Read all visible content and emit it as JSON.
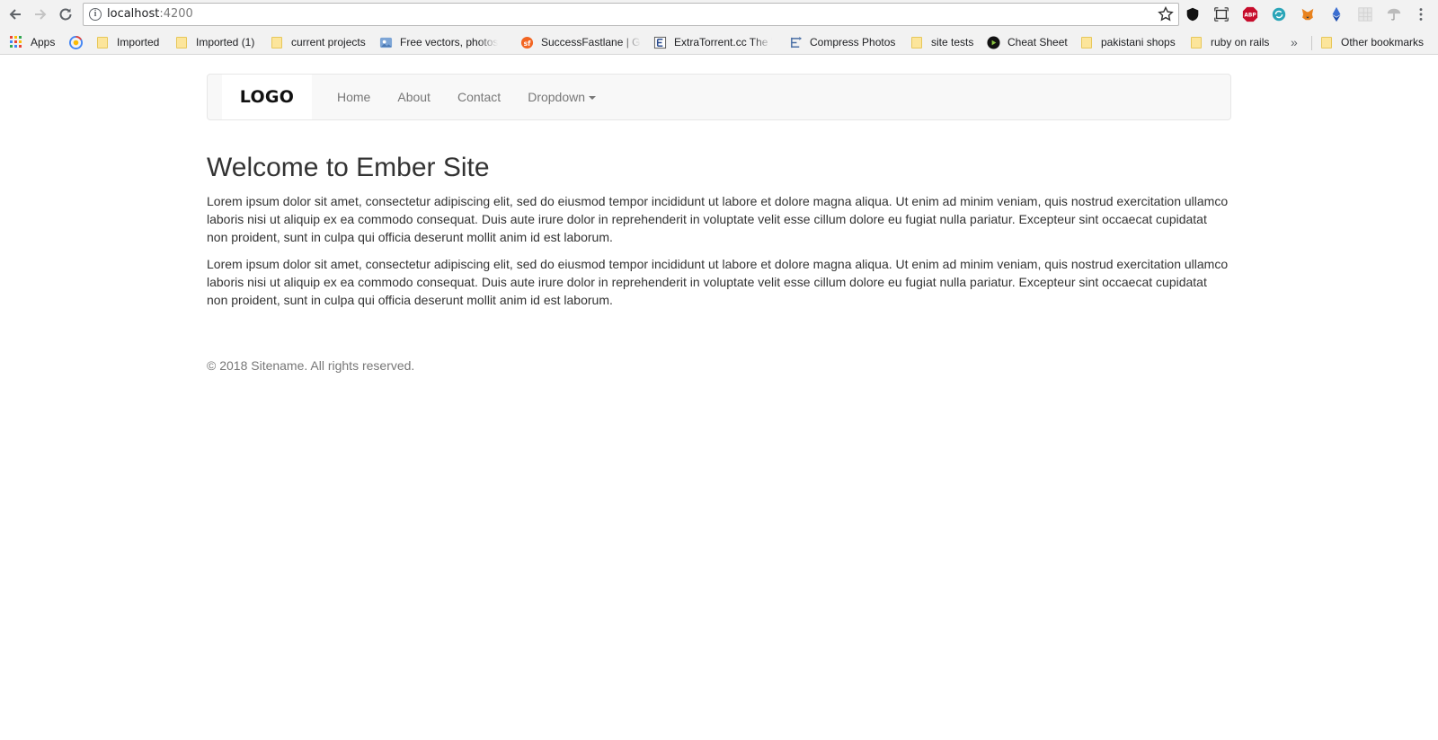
{
  "browser": {
    "url_host": "localhost",
    "url_port": ":4200",
    "extensions": [
      "shield-icon",
      "screenshot-icon",
      "adblock-icon",
      "refresh-circle-icon",
      "metamask-fox-icon",
      "ethereum-icon",
      "grid-extension-icon",
      "umbrella-icon",
      "more-vert-icon"
    ],
    "adblock_label": "ABP",
    "bookmarks": [
      {
        "label": "Apps",
        "icon": "apps-grid-icon"
      },
      {
        "label": "",
        "icon": "chrome-webstore-icon"
      },
      {
        "label": "Imported",
        "icon": "folder-icon"
      },
      {
        "label": "Imported (1)",
        "icon": "folder-icon"
      },
      {
        "label": "current projects",
        "icon": "folder-icon"
      },
      {
        "label": "Free vectors, photos",
        "icon": "freepik-icon"
      },
      {
        "label": "SuccessFastlane | Ge",
        "icon": "successfastlane-icon"
      },
      {
        "label": "ExtraTorrent.cc The W",
        "icon": "extratorrent-icon"
      },
      {
        "label": "Compress Photos",
        "icon": "compress-icon"
      },
      {
        "label": "site tests",
        "icon": "folder-icon"
      },
      {
        "label": "Cheat Sheet",
        "icon": "cheatsheet-icon"
      },
      {
        "label": "pakistani shops",
        "icon": "folder-icon"
      },
      {
        "label": "ruby on rails",
        "icon": "folder-icon"
      }
    ],
    "overflow_label": "»",
    "other_bookmarks": "Other bookmarks"
  },
  "site": {
    "logo": "LOGO",
    "nav": [
      "Home",
      "About",
      "Contact",
      "Dropdown"
    ],
    "heading": "Welcome to Ember Site",
    "paragraphs": [
      "Lorem ipsum dolor sit amet, consectetur adipiscing elit, sed do eiusmod tempor incididunt ut labore et dolore magna aliqua. Ut enim ad minim veniam, quis nostrud exercitation ullamco laboris nisi ut aliquip ex ea commodo consequat. Duis aute irure dolor in reprehenderit in voluptate velit esse cillum dolore eu fugiat nulla pariatur. Excepteur sint occaecat cupidatat non proident, sunt in culpa qui officia deserunt mollit anim id est laborum.",
      "Lorem ipsum dolor sit amet, consectetur adipiscing elit, sed do eiusmod tempor incididunt ut labore et dolore magna aliqua. Ut enim ad minim veniam, quis nostrud exercitation ullamco laboris nisi ut aliquip ex ea commodo consequat. Duis aute irure dolor in reprehenderit in voluptate velit esse cillum dolore eu fugiat nulla pariatur. Excepteur sint occaecat cupidatat non proident, sunt in culpa qui officia deserunt mollit anim id est laborum."
    ],
    "footer": "© 2018 Sitename. All rights reserved."
  }
}
